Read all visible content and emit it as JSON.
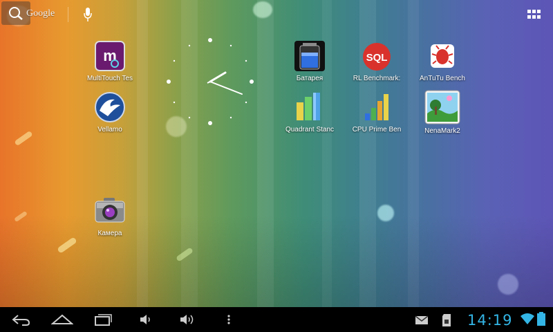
{
  "search": {
    "label": "Google"
  },
  "apps": {
    "multitouch": "MultiTouch Tes",
    "battery": "Батарея",
    "rlbench": "RL Benchmark:",
    "antutu": "AnTuTu Bench",
    "vellamo": "Vellamo",
    "quadrant": "Quadrant Stanc",
    "cpuprime": "CPU Prime Ben",
    "nenamark": "NenaMark2",
    "camera": "Камера"
  },
  "icons": {
    "multitouch": "multitouch-icon",
    "battery": "battery-icon",
    "rlbench": "sql-icon",
    "antutu": "antutu-icon",
    "vellamo": "vellamo-icon",
    "quadrant": "bar-chart-icon",
    "cpuprime": "bar-chart-icon",
    "nenamark": "landscape-icon",
    "camera": "camera-icon"
  },
  "statusbar": {
    "time": "14:19"
  },
  "colors": {
    "accent": "#33b5e5",
    "navbar": "#000000"
  }
}
